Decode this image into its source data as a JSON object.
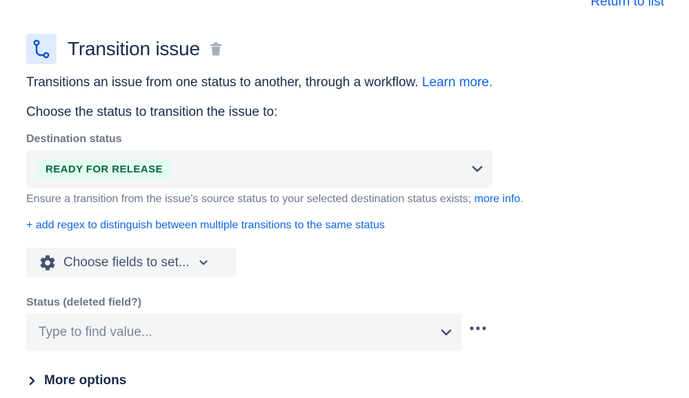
{
  "header": {
    "return_link": "Return to list",
    "title": "Transition issue",
    "icon": "transition-icon",
    "delete_icon": "trash-icon"
  },
  "description": {
    "text": "Transitions an issue from one status to another, through a workflow.",
    "learn_more": "Learn more."
  },
  "choose_status_text": "Choose the status to transition the issue to:",
  "destination": {
    "label": "Destination status",
    "value": "READY FOR RELEASE",
    "helper_text": "Ensure a transition from the issue's source status to your selected destination status exists;",
    "helper_link": "more info",
    "helper_suffix": "."
  },
  "regex_link": "+ add regex to distinguish between multiple transitions to the same status",
  "fields_button": {
    "label": "Choose fields to set...",
    "icon": "gear-icon"
  },
  "status_field": {
    "label": "Status (deleted field?)",
    "placeholder": "Type to find value...",
    "value": ""
  },
  "more_options": {
    "label": "More options"
  },
  "colors": {
    "link": "#0C66E4",
    "lozenge_bg": "#E3FCEF",
    "lozenge_text": "#006644",
    "field_bg": "#F4F5F7",
    "icon_bg": "#DEEBFF"
  }
}
